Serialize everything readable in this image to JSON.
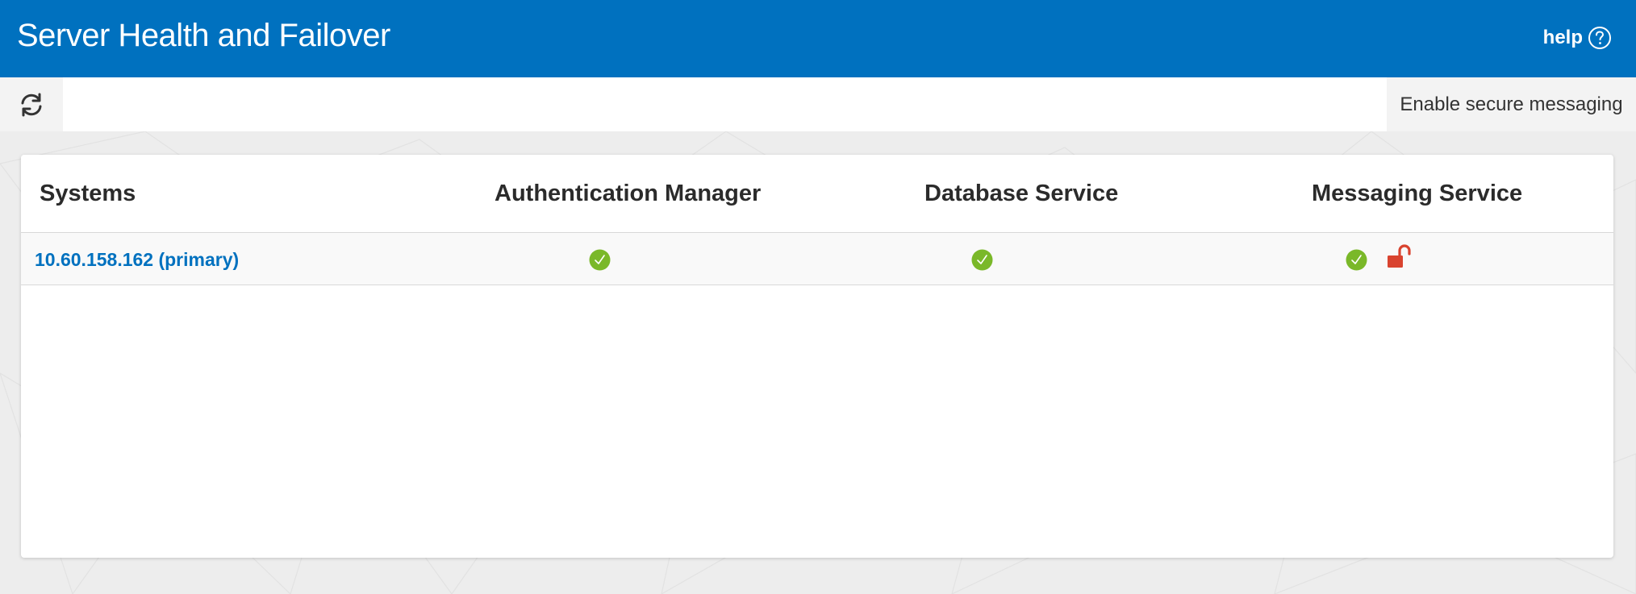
{
  "header": {
    "title": "Server Health and Failover",
    "help_label": "help",
    "background_color": "#0071bf"
  },
  "toolbar": {
    "refresh_icon": "refresh-icon",
    "secure_messaging_label": "Enable secure messaging"
  },
  "table": {
    "columns": [
      "Systems",
      "Authentication Manager",
      "Database Service",
      "Messaging Service"
    ],
    "rows": [
      {
        "system": "10.60.158.162 (primary)",
        "authentication_manager": "ok",
        "database_service": "ok",
        "messaging_service": "ok",
        "messaging_secure": "unlocked"
      }
    ]
  },
  "colors": {
    "status_ok": "#7ab829",
    "lock_insecure": "#d9432f",
    "link": "#0071bf"
  }
}
